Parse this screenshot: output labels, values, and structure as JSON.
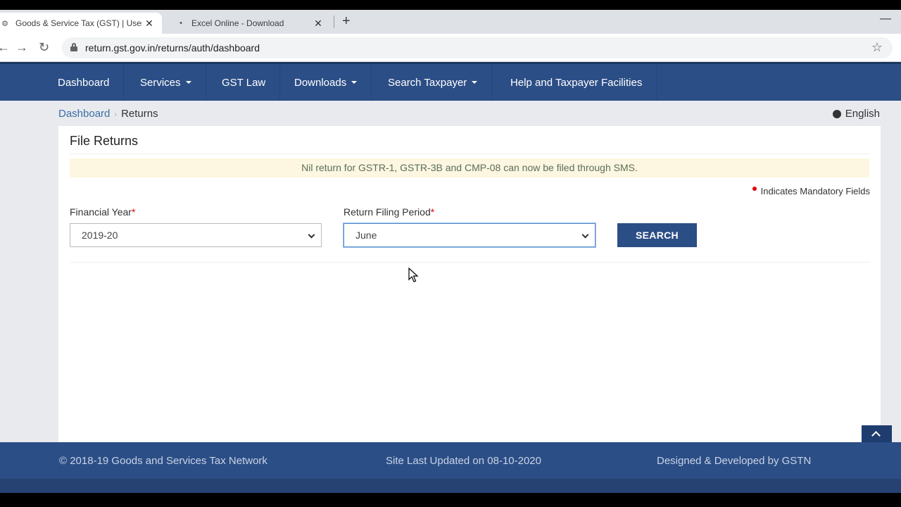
{
  "browser": {
    "tabs": [
      {
        "title": "Goods & Service Tax (GST) | User",
        "active": true
      },
      {
        "title": "Excel Online - Download",
        "active": false
      }
    ],
    "url": "return.gst.gov.in/returns/auth/dashboard"
  },
  "nav": {
    "items": [
      {
        "label": "Dashboard",
        "dropdown": false
      },
      {
        "label": "Services",
        "dropdown": true
      },
      {
        "label": "GST Law",
        "dropdown": false
      },
      {
        "label": "Downloads",
        "dropdown": true
      },
      {
        "label": "Search Taxpayer",
        "dropdown": true
      },
      {
        "label": "Help and Taxpayer Facilities",
        "dropdown": false
      }
    ]
  },
  "breadcrumb": {
    "home": "Dashboard",
    "current": "Returns"
  },
  "language": "English",
  "panel": {
    "title": "File Returns",
    "notice": "Nil return for GSTR-1, GSTR-3B and CMP-08 can now be filed through SMS.",
    "mandatory_note": "Indicates Mandatory Fields",
    "financial_year": {
      "label": "Financial Year",
      "value": "2019-20"
    },
    "return_period": {
      "label": "Return Filing Period",
      "value": "June"
    },
    "search_label": "SEARCH"
  },
  "footer": {
    "copyright": "© 2018-19 Goods and Services Tax Network",
    "updated": "Site Last Updated on 08-10-2020",
    "credit": "Designed & Developed by GSTN"
  },
  "colors": {
    "brand": "#2c4e86",
    "notice_bg": "#fdf6e0",
    "required": "#dd0000"
  }
}
